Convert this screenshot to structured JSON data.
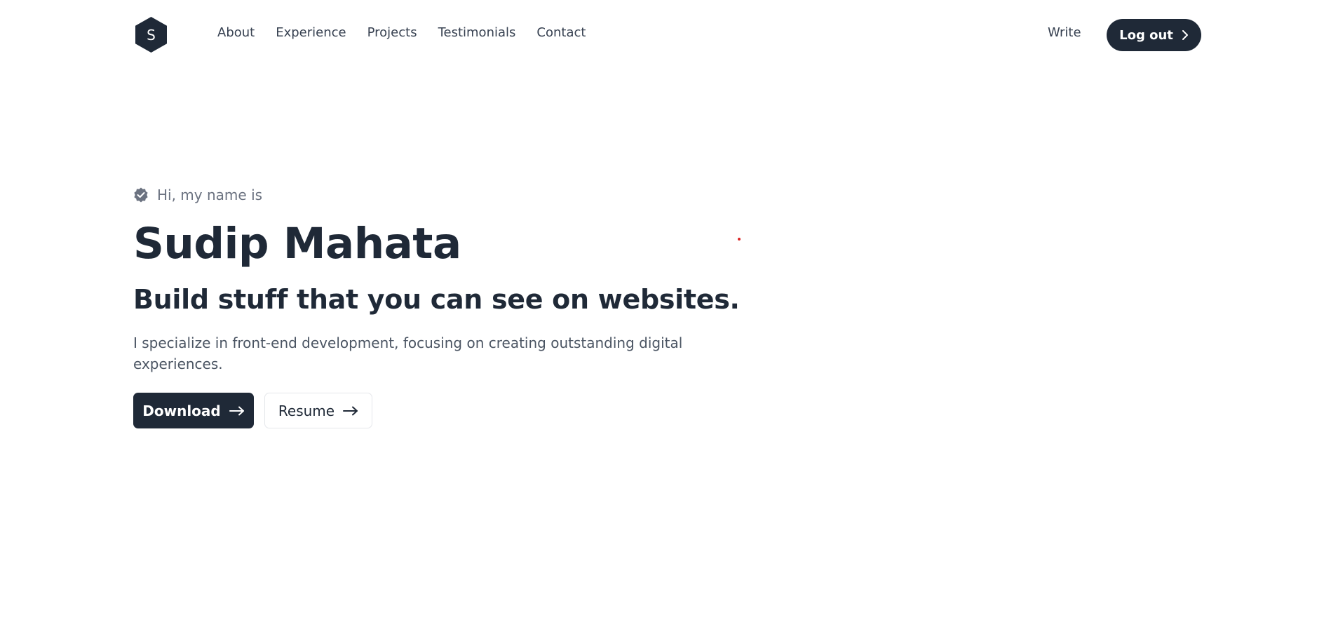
{
  "header": {
    "logo": {
      "letter": "S",
      "icon": "hexagon-logo-icon"
    },
    "nav": [
      {
        "label": "About"
      },
      {
        "label": "Experience"
      },
      {
        "label": "Projects"
      },
      {
        "label": "Testimonials"
      },
      {
        "label": "Contact"
      }
    ],
    "write_label": "Write",
    "logout_label": "Log out"
  },
  "hero": {
    "intro": "Hi, my name is",
    "name": "Sudip Mahata",
    "tagline": "Build stuff that you can see on websites.",
    "description": "I specialize in front-end development, focusing on creating outstanding digital experiences.",
    "download_label": "Download",
    "resume_label": "Resume"
  },
  "colors": {
    "primary": "#1f2937",
    "muted": "#6b7280",
    "accent_dot": "#dc2626"
  }
}
